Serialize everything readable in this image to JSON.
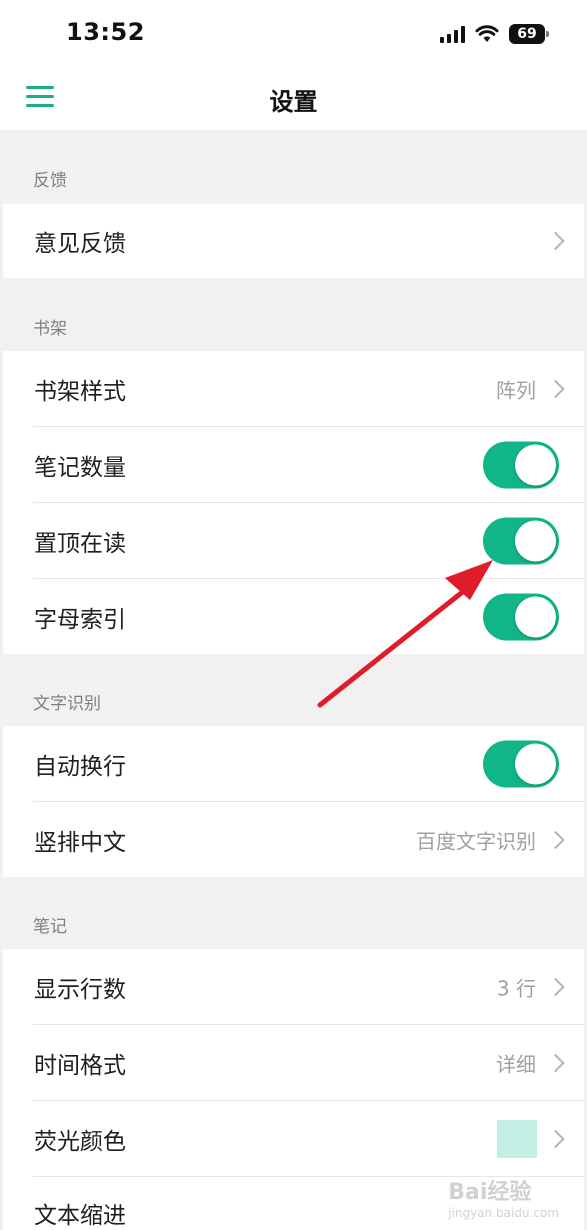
{
  "status_bar": {
    "time": "13:52",
    "battery": "69"
  },
  "nav": {
    "title": "设置",
    "menu_icon": "hamburger-menu-icon"
  },
  "sections": {
    "feedback": {
      "header": "反馈",
      "rows": {
        "feedback": {
          "label": "意见反馈"
        }
      }
    },
    "bookshelf": {
      "header": "书架",
      "rows": {
        "style": {
          "label": "书架样式",
          "value": "阵列"
        },
        "note_count": {
          "label": "笔记数量",
          "on": true
        },
        "pin_reading": {
          "label": "置顶在读",
          "on": true
        },
        "alpha_index": {
          "label": "字母索引",
          "on": true
        }
      }
    },
    "ocr": {
      "header": "文字识别",
      "rows": {
        "auto_wrap": {
          "label": "自动换行",
          "on": true
        },
        "vertical_chinese": {
          "label": "竖排中文",
          "value": "百度文字识别"
        }
      }
    },
    "notes": {
      "header": "笔记",
      "rows": {
        "line_count": {
          "label": "显示行数",
          "value": "3 行"
        },
        "time_format": {
          "label": "时间格式",
          "value": "详细"
        },
        "highlight_color": {
          "label": "荧光颜色",
          "swatch": "#c4eee3"
        },
        "text_indent": {
          "label": "文本缩进"
        }
      }
    }
  },
  "colors": {
    "accent": "#10b688",
    "annotation_arrow": "#e01b2a"
  },
  "watermark": {
    "text": "Bai经验",
    "sub": "jingyan.baidu.com"
  }
}
